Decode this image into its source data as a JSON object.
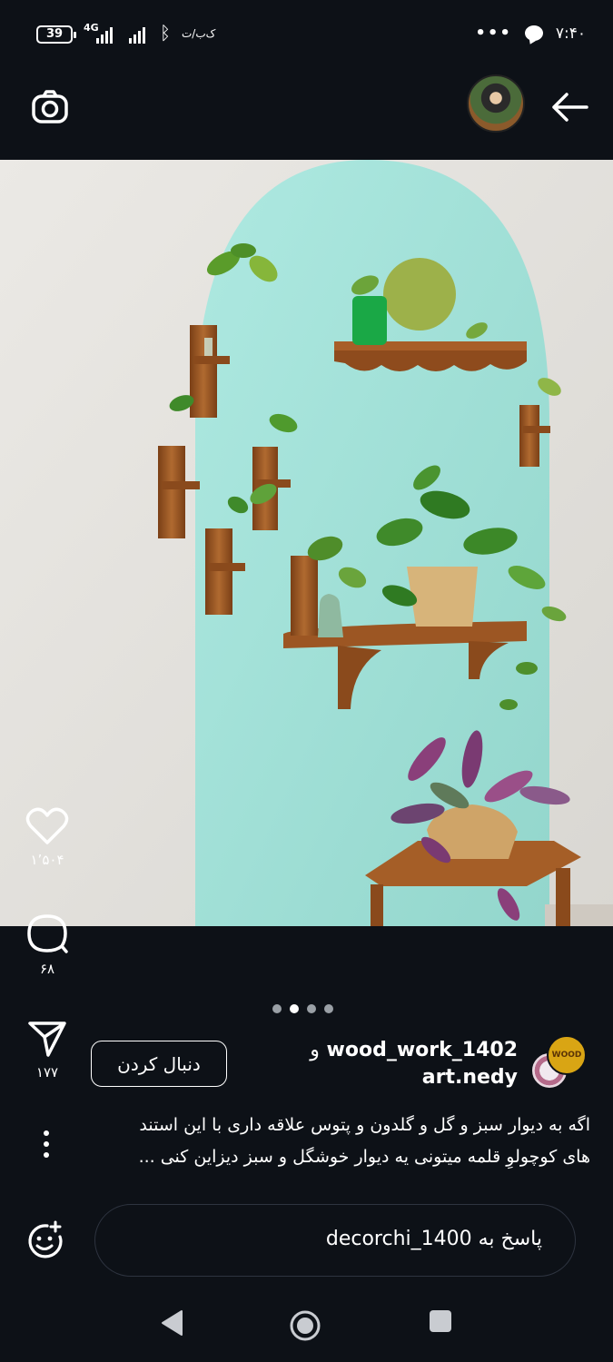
{
  "status_bar": {
    "battery": "39",
    "network": "4G",
    "carrier": "ک‌ب/ت",
    "time": "۷:۴۰",
    "more": "•••"
  },
  "actions": {
    "likes": "۱٬۵۰۴",
    "comments": "۶۸",
    "shares": "۱۷۷"
  },
  "carousel": {
    "count": 4,
    "active_index": 1
  },
  "post": {
    "follow_label": "دنبال کردن",
    "username_1": "wood_work_1402",
    "and_word": "و",
    "username_2": "art.nedy",
    "caption_line1": "اگه به دیوار سبز و گل و گلدون و پتوس علاقه داری با این استند",
    "caption_line2": "های کوچولوِ قلمه میتونی یه دیوار خوشگل و سبز دیزاین کنی ...",
    "avatar_badge": "WOOD"
  },
  "reply": {
    "placeholder": "پاسخ به decorchi_1400"
  },
  "icons": {
    "camera": "camera-icon",
    "back": "arrow-right-icon",
    "like": "heart-icon",
    "comment": "comment-icon",
    "share": "send-icon",
    "more": "more-vertical-icon",
    "emoji": "emoji-add-icon"
  },
  "colors": {
    "background": "#0d1117",
    "wall_mint": "#a6e4dc",
    "wood": "#9b5a26"
  }
}
